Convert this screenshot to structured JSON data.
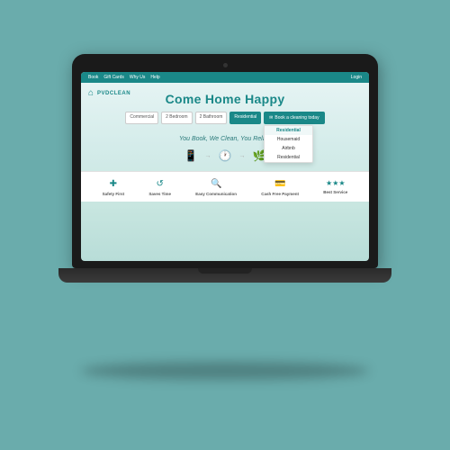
{
  "laptop": {
    "bg_color": "#6aacac"
  },
  "navbar": {
    "items": [
      "Book",
      "Gift Cards",
      "Why Us",
      "Help"
    ],
    "login": "Login"
  },
  "logo": {
    "text": "PVDCLEAN",
    "icon": "🏠"
  },
  "hero": {
    "title": "Come Home Happy",
    "subtitle": "You Book, We Clean, You Relax."
  },
  "form": {
    "commercial_label": "Commercial",
    "bedroom_label": "2 Bedroom",
    "bathroom_label": "2 Bathroom",
    "type_label": "Residential",
    "book_label": "Book a cleaning today",
    "dropdown_options": [
      "Residential",
      "Housemaid",
      "Airbnb",
      "Residential"
    ]
  },
  "features": [
    {
      "label": "Safety First",
      "icon": "✚"
    },
    {
      "label": "Saves Time",
      "icon": "↺"
    },
    {
      "label": "Easy Communication",
      "icon": "🔍"
    },
    {
      "label": "Cash Free Payment",
      "icon": "💳"
    },
    {
      "label": "Best Service",
      "icon": "★★★"
    }
  ]
}
